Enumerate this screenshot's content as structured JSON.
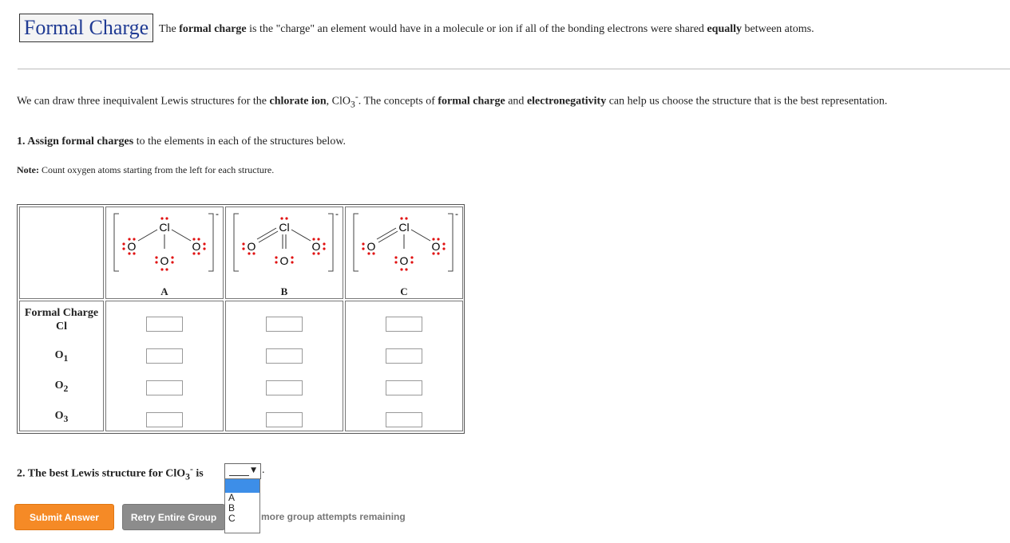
{
  "header": {
    "title": "Formal Charge",
    "desc_pre": "The ",
    "desc_b1": "formal charge",
    "desc_mid": " is the \"charge\" an element would have in a molecule or ion if all of the bonding electrons were shared ",
    "desc_b2": "equally",
    "desc_post": " between atoms."
  },
  "intro": {
    "t1": "We can draw three inequivalent Lewis structures for the ",
    "b1": "chlorate ion",
    "t2": ", ClO",
    "sub": "3",
    "sup": "-",
    "t3": ". The concepts of ",
    "b2": "formal charge",
    "t4": " and ",
    "b3": "electronegativity",
    "t5": " can help us choose the structure that is the best representation."
  },
  "question1": {
    "num": "1. ",
    "bold": "Assign formal charges",
    "rest": " to the elements in each of the structures below."
  },
  "note": {
    "label": "Note:",
    "text": " Count oxygen atoms starting from the left for each structure."
  },
  "structures": {
    "labels": [
      "A",
      "B",
      "C"
    ],
    "atom_cl": "Cl",
    "atom_o": "O",
    "charge": "-"
  },
  "rows": {
    "heading": "Formal Charge",
    "cl": "Cl",
    "o": "O",
    "subs": [
      "1",
      "2",
      "3"
    ]
  },
  "question2": {
    "prefix": "2. The best Lewis structure for ClO",
    "sub": "3",
    "sup": "-",
    "suffix": " is",
    "after": "."
  },
  "select": {
    "options": [
      "",
      "A",
      "B",
      "C"
    ],
    "selected": ""
  },
  "buttons": {
    "submit": "Submit Answer",
    "retry": "Retry Entire Group"
  },
  "remaining": "more group attempts remaining",
  "colors": {
    "title": "#1f3a93",
    "lone_pair": "#e01010",
    "submit": "#f58a26",
    "retry": "#8c8c8c",
    "dropdown_selected": "#3d8ee8"
  }
}
